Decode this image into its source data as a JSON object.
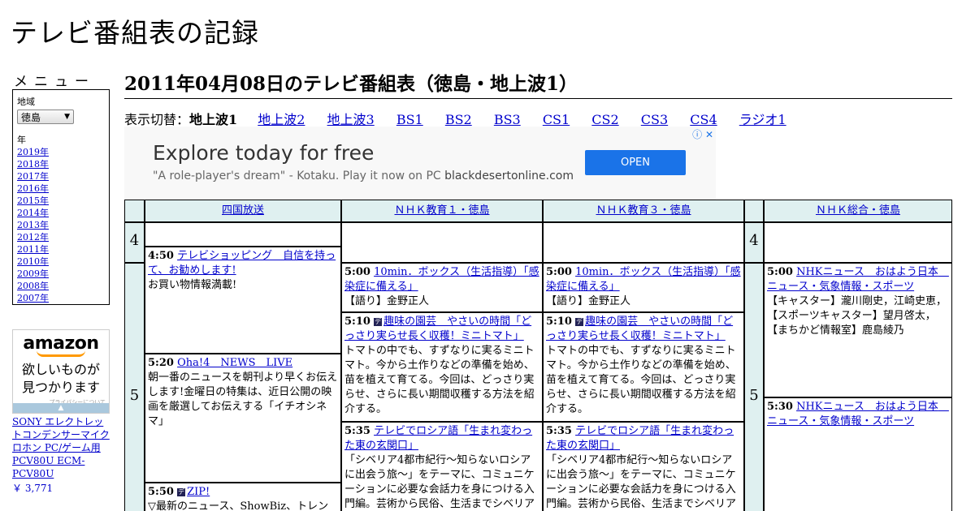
{
  "site_title": "テレビ番組表の記録",
  "sidebar": {
    "menu_title": "メニュー",
    "region_label": "地域",
    "region_value": "徳島",
    "year_label": "年",
    "years": [
      "2019年",
      "2018年",
      "2017年",
      "2016年",
      "2015年",
      "2014年",
      "2013年",
      "2012年",
      "2011年",
      "2010年",
      "2009年",
      "2008年",
      "2007年"
    ]
  },
  "amazon_ad": {
    "brand": "amazon",
    "message_line1": "欲しいものが",
    "message_line2": "見つかります",
    "privacy": "プライバシーについて",
    "product": "SONY エレクトレットコンデンサーマイクロホン PC/ゲーム用 PCV80U ECM-PCV80U",
    "price": "￥ 3,771"
  },
  "main": {
    "heading": "2011年04月08日のテレビ番組表（徳島・地上波1）",
    "switch_label": "表示切替：",
    "switch_current": "地上波1",
    "switch_links": [
      "地上波2",
      "地上波3",
      "BS1",
      "BS2",
      "BS3",
      "CS1",
      "CS2",
      "CS3",
      "CS4",
      "ラジオ1"
    ]
  },
  "banner_ad": {
    "headline": "Explore today for free",
    "sub_quote": "\"A role-player's dream\" - Kotaku. Play it now on PC",
    "sub_domain": "blackdesertonline.com",
    "button": "OPEN",
    "accent": "#1a73e8"
  },
  "schedule": {
    "channels": [
      "四国放送",
      "ＮＨＫ教育１・徳島",
      "ＮＨＫ教育３・徳島",
      "ＮＨＫ総合・徳島"
    ],
    "hours": [
      "4",
      "5"
    ],
    "ch1": [
      {
        "time": "4:50",
        "title": "テレビショッピング　自信を持って、お勧めします!",
        "desc": "お買い物情報満載!"
      },
      {
        "time": "5:20",
        "title": "Oha!4　NEWS　LIVE",
        "desc": "朝一番のニュースを朝刊より早くお伝えします!金曜日の特集は、近日公開の映画を厳選してお伝えする「イチオシネマ」"
      },
      {
        "time": "5:50",
        "title": "ZIP!",
        "desc": "▽最新のニュース、ShowBiz、トレンド"
      }
    ],
    "ch2": [
      {
        "time": "5:00",
        "title": "10min．ボックス（生活指導）「感染症に備える」",
        "desc": "【語り】金野正人"
      },
      {
        "time": "5:10",
        "title": "趣味の園芸　やさいの時間「どっさり実らせ長く収穫！ミニトマト」",
        "desc": "トマトの中でも、すずなりに実るミニトマト。今から土作りなどの準備を始め、苗を植えて育てる。今回は、どっさり実らせ、さらに長い期間収穫する方法を紹介する。"
      },
      {
        "time": "5:35",
        "title": "テレビでロシア語「生まれ変わった東の玄関口」",
        "desc": "「シベリア4都市紀行～知らないロシアに出会う旅～」をテーマに、コミュニケーションに必要な会話力を身につける入門編。芸術から民俗、生活までシベリア"
      }
    ],
    "ch3": [
      {
        "time": "5:00",
        "title": "10min．ボックス（生活指導）「感染症に備える」",
        "desc": "【語り】金野正人"
      },
      {
        "time": "5:10",
        "title": "趣味の園芸　やさいの時間「どっさり実らせ長く収穫！ミニトマト」",
        "desc": "トマトの中でも、すずなりに実るミニトマト。今から土作りなどの準備を始め、苗を植えて育てる。今回は、どっさり実らせ、さらに長い期間収穫する方法を紹介する。"
      },
      {
        "time": "5:35",
        "title": "テレビでロシア語「生まれ変わった東の玄関口」",
        "desc": "「シベリア4都市紀行～知らないロシアに出会う旅～」をテーマに、コミュニケーションに必要な会話力を身につける入門編。芸術から民俗、生活までシベリア"
      }
    ],
    "ch4": [
      {
        "time": "5:00",
        "title": "NHKニュース　おはよう日本　ニュース・気象情報・スポーツ",
        "desc": "【キャスター】瀧川剛史，江崎史恵，【スポーツキャスター】望月啓太，【まちかど情報室】鹿島綾乃"
      },
      {
        "time": "5:30",
        "title": "NHKニュース　おはよう日本　ニュース・気象情報・スポーツ",
        "desc": ""
      }
    ]
  }
}
